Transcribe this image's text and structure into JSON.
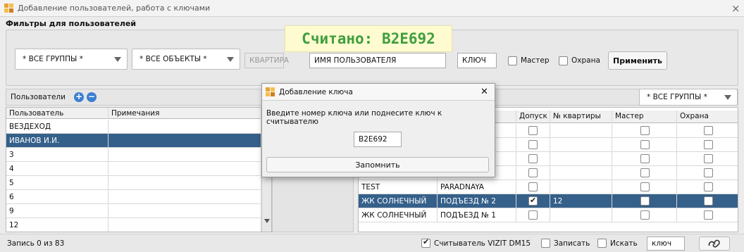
{
  "window": {
    "title": "Добавление пользователей, работа с ключами",
    "close": "×"
  },
  "filters": {
    "section_label": "Фильтры для пользователей",
    "group_combo": "* ВСЕ ГРУППЫ *",
    "object_combo": "* ВСЕ ОБЪЕКТЫ *",
    "apartment_placeholder": "КВАРТИРА",
    "user_name_placeholder": "ИМЯ ПОЛЬЗОВАТЕЛЯ",
    "key_placeholder": "КЛЮЧ",
    "master_label": "Мастер",
    "guard_label": "Охрана",
    "apply_button": "Применить"
  },
  "banner": {
    "text": "Считано: B2E692"
  },
  "users": {
    "title": "Пользователи",
    "add": "+",
    "remove": "−",
    "columns": [
      "Пользователь",
      "Примечания"
    ],
    "rows": [
      {
        "name": "ВЕЗДЕХОД",
        "note": ""
      },
      {
        "name": "ИВАНОВ И.И.",
        "note": "",
        "selected": true
      },
      {
        "name": "3",
        "note": ""
      },
      {
        "name": "4",
        "note": ""
      },
      {
        "name": "5",
        "note": ""
      },
      {
        "name": "6",
        "note": ""
      },
      {
        "name": "9",
        "note": ""
      },
      {
        "name": "12",
        "note": ""
      }
    ]
  },
  "access": {
    "group_combo": "* ВСЕ ГРУППЫ *",
    "columns": [
      "Допуск",
      "№ квартиры",
      "Мастер",
      "Охрана"
    ],
    "rows": [
      {
        "object": "",
        "entrance": "",
        "access": false,
        "apt": "",
        "master": false,
        "guard": false
      },
      {
        "object": "",
        "entrance": "",
        "access": false,
        "apt": "",
        "master": false,
        "guard": false
      },
      {
        "object": "",
        "entrance": "",
        "access": false,
        "apt": "",
        "master": false,
        "guard": false
      },
      {
        "object": "",
        "entrance": "",
        "access": false,
        "apt": "",
        "master": false,
        "guard": false
      },
      {
        "object": "TEST",
        "entrance": "PARADNAYA",
        "access": false,
        "apt": "",
        "master": false,
        "guard": false
      },
      {
        "object": "ЖК СОЛНЕЧНЫЙ",
        "entrance": "ПОДЪЕЗД № 2",
        "access": true,
        "apt": "12",
        "master": false,
        "guard": false,
        "selected": true
      },
      {
        "object": "ЖК СОЛНЕЧНЫЙ",
        "entrance": "ПОДЪЕЗД № 1",
        "access": false,
        "apt": "",
        "master": false,
        "guard": false
      }
    ]
  },
  "dialog": {
    "title": "Добавление ключа",
    "close": "✕",
    "prompt": "Введите номер ключа или поднесите ключ к считывателю",
    "key_value": "B2E692",
    "save_button": "Запомнить"
  },
  "status": {
    "record_text": "Запись 0  из 83",
    "reader_label": "Считыватель  VIZIT DM15",
    "reader_checked": true,
    "write_label": "Записать",
    "search_label": "Искать",
    "key_field": "ключ",
    "link_icon": "link-icon"
  }
}
